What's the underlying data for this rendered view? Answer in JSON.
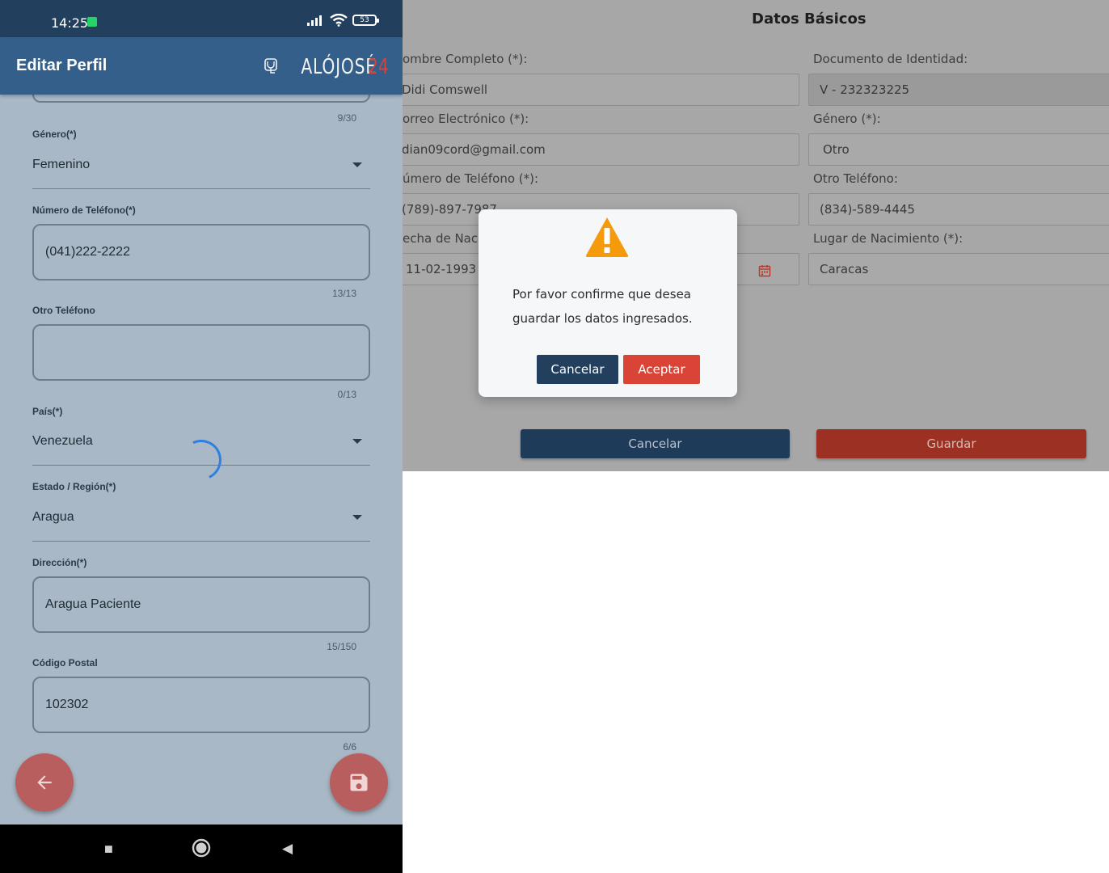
{
  "phone": {
    "status": {
      "time": "14:25",
      "battery": "53"
    },
    "app_bar": {
      "title": "Editar Perfil",
      "logo_main": "ALÓJOSÉ",
      "logo_accent": "24"
    },
    "form": {
      "name_counter": "9/30",
      "genero": {
        "label": "Género(*)",
        "value": "Femenino"
      },
      "telefono": {
        "label": "Número de Teléfono(*)",
        "value": "(041)222-2222",
        "counter": "13/13"
      },
      "otro_telefono": {
        "label": "Otro Teléfono",
        "value": "",
        "counter": "0/13"
      },
      "pais": {
        "label": "País(*)",
        "value": "Venezuela"
      },
      "estado": {
        "label": "Estado / Región(*)",
        "value": "Aragua"
      },
      "direccion": {
        "label": "Dirección(*)",
        "value": "Aragua Paciente",
        "counter": "15/150"
      },
      "codigo_postal": {
        "label": "Código Postal",
        "value": "102302",
        "counter": "6/6"
      }
    },
    "fab": {
      "back_icon": "arrow-left-icon",
      "save_icon": "floppy-disk-icon",
      "color": "#b85e5e"
    },
    "nav": {
      "square": "■",
      "home": "●",
      "back": "◀"
    }
  },
  "web": {
    "title": "Datos Básicos",
    "fields": {
      "nombre": {
        "label": "ombre Completo (*):",
        "value": "Didi Comswell"
      },
      "documento": {
        "label": "Documento de Identidad:",
        "value": "V - 232323225"
      },
      "correo": {
        "label": "orreo Electrónico (*):",
        "value": "dian09cord@gmail.com"
      },
      "genero": {
        "label": "Género (*):",
        "value": "Otro"
      },
      "telefono": {
        "label": "úmero de Teléfono (*):",
        "value": "(789)-897-7987"
      },
      "otro_telefono": {
        "label": "Otro Teléfono:",
        "value": "(834)-589-4445"
      },
      "fecha": {
        "label": "echa de Nac",
        "value": "11-02-1993"
      },
      "lugar": {
        "label": "Lugar de Nacimiento (*):",
        "value": "Caracas"
      }
    },
    "buttons": {
      "cancel": "Cancelar",
      "save": "Guardar"
    },
    "colors": {
      "cancel": "#1f3b5a",
      "save": "#9c3023"
    }
  },
  "dialog": {
    "icon": "warning-icon",
    "message": "Por favor confirme que desea guardar los datos ingresados.",
    "cancel": "Cancelar",
    "accept": "Aceptar",
    "colors": {
      "cancel": "#223f5e",
      "accept": "#d94436",
      "icon": "#f59a0b"
    }
  }
}
